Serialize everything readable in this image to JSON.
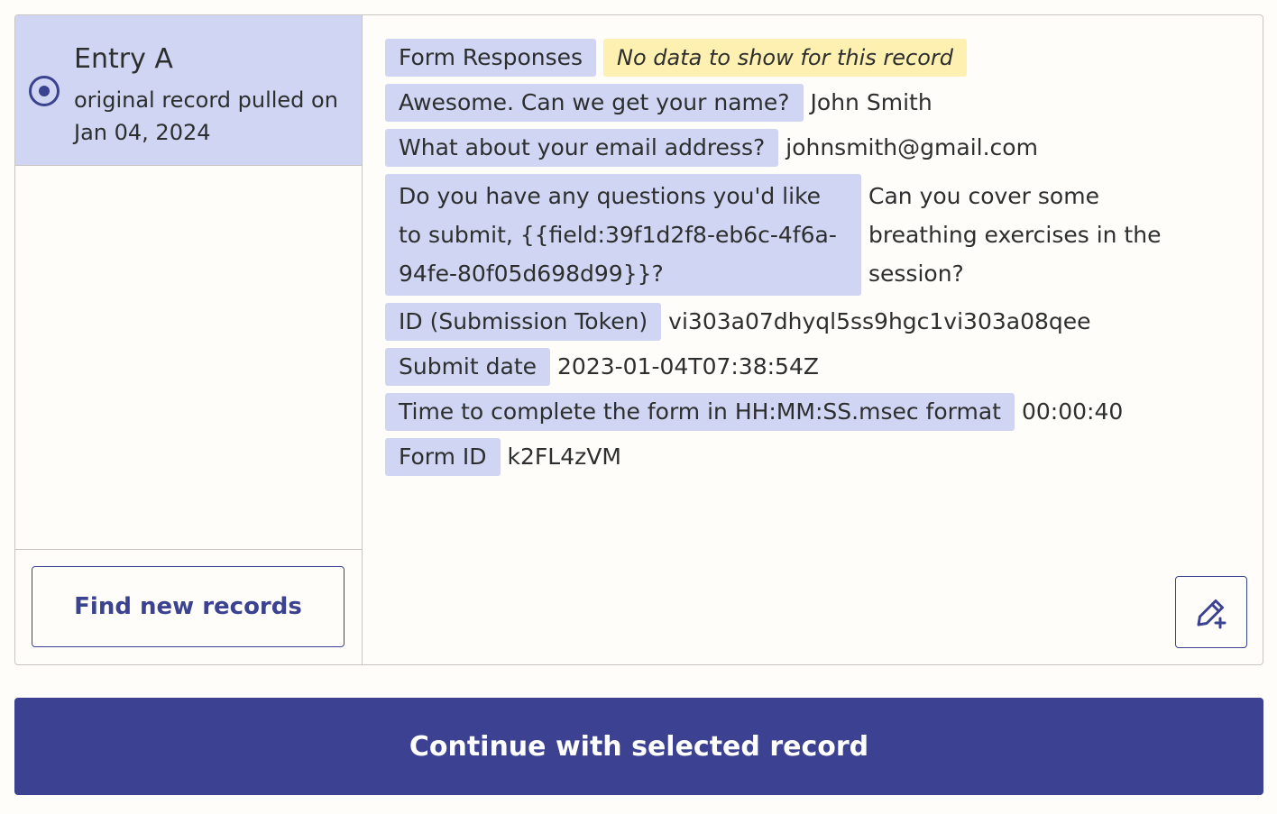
{
  "entry": {
    "title": "Entry A",
    "subtitle": "original record pulled on Jan 04, 2024",
    "selected": true
  },
  "left_footer": {
    "find_label": "Find new records"
  },
  "record": {
    "section_label": "Form Responses",
    "no_data_notice": "No data to show for this record",
    "fields": [
      {
        "label": "Awesome. Can we get your name?",
        "value": "John Smith"
      },
      {
        "label": "What about your email address?",
        "value": "johnsmith@gmail.com"
      },
      {
        "label": "Do you have any questions you'd like to submit, {{field:39f1d2f8-eb6c-4f6a-94fe-80f05d698d99}}?",
        "value": "Can you cover some breathing exercises in the session?"
      },
      {
        "label": "ID (Submission Token)",
        "value": "vi303a07dhyql5ss9hgc1vi303a08qee"
      },
      {
        "label": "Submit date",
        "value": "2023-01-04T07:38:54Z"
      },
      {
        "label": "Time to complete the form in HH:MM:SS.msec format",
        "value": "00:00:40"
      },
      {
        "label": "Form ID",
        "value": "k2FL4zVM"
      }
    ]
  },
  "edit_button": {
    "icon": "edit-plus-icon"
  },
  "continue_label": "Continue with selected record",
  "colors": {
    "accent": "#3c4291",
    "label_bg": "#d0d5f3",
    "notice_bg": "#fdf0b1",
    "page_bg": "#fffdf9",
    "border": "#c9c6c1"
  }
}
